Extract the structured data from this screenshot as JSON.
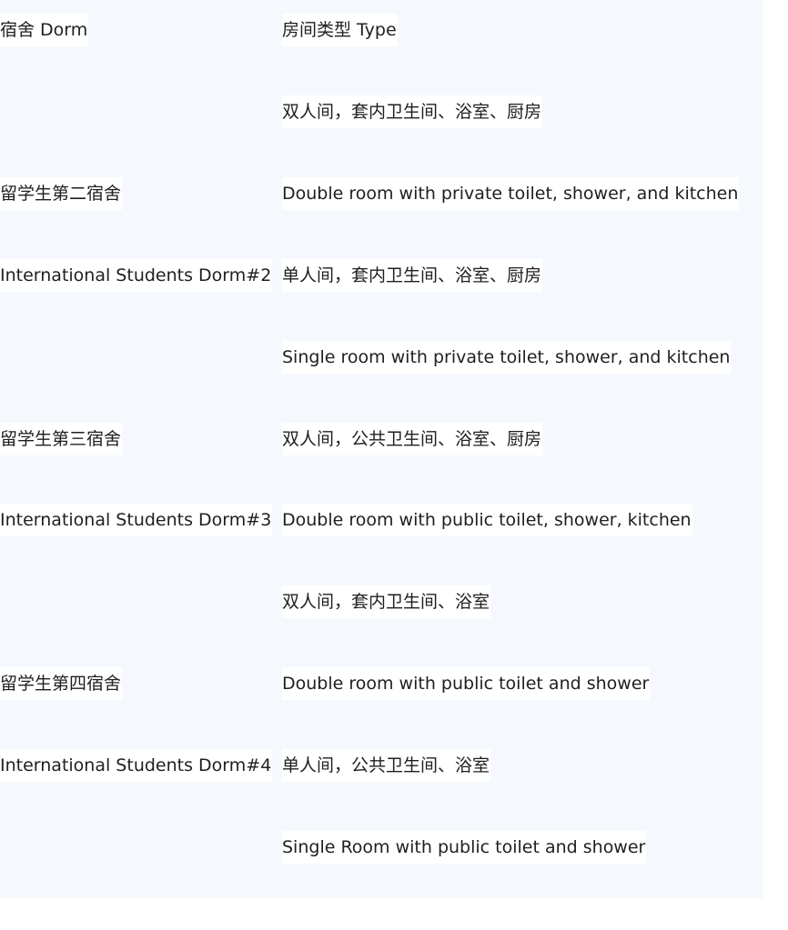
{
  "header": {
    "dorm": "宿舍 Dorm",
    "type": "房间类型 Type"
  },
  "dorms": [
    {
      "name_cn": "留学生第二宿舍",
      "name_en": "International Students Dorm#2"
    },
    {
      "name_cn": "留学生第三宿舍",
      "name_en": "International Students Dorm#3"
    },
    {
      "name_cn": "留学生第四宿舍",
      "name_en": "International Students Dorm#4"
    }
  ],
  "room_types": [
    "双人间，套内卫生间、浴室、厨房",
    "Double room with private toilet, shower, and kitchen",
    "单人间，套内卫生间、浴室、厨房",
    "Single room with private toilet, shower, and kitchen",
    "双人间，公共卫生间、浴室、厨房",
    "Double room with public toilet, shower, kitchen",
    "双人间，套内卫生间、浴室",
    "Double room with public toilet and shower",
    "单人间，公共卫生间、浴室",
    "Single Room with public toilet and shower"
  ]
}
